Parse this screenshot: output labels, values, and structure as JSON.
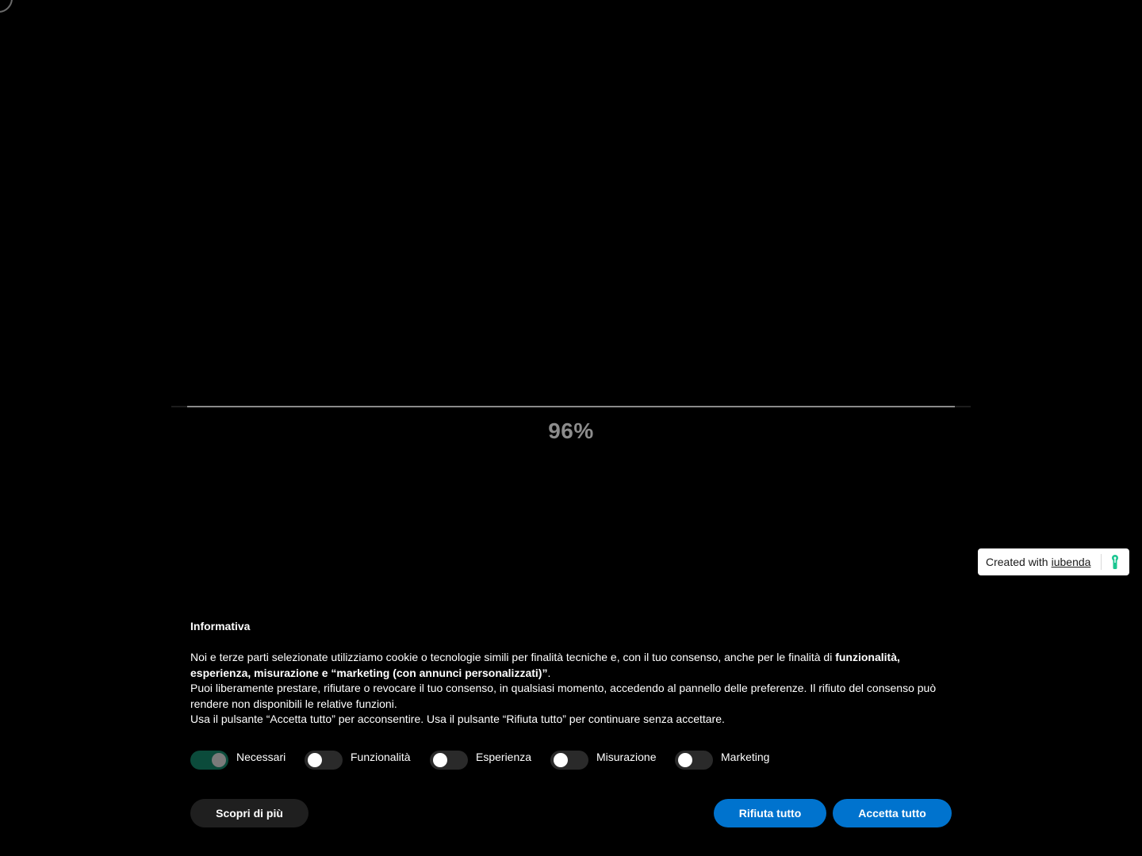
{
  "loader": {
    "percent_label": "96%",
    "progress": 0.96
  },
  "iubenda": {
    "prefix": "Created with",
    "link": "iubenda",
    "icon": "iubenda-keyhole-icon",
    "icon_color": "#1cc691"
  },
  "banner": {
    "title": "Informativa",
    "text_line1_a": "Noi e terze parti selezionate utilizziamo cookie o tecnologie simili per finalità tecniche e, con il tuo consenso, anche per le finalità di ",
    "text_line1_b": "funzionalità, esperienza, misurazione e “marketing (con annunci personalizzati)”",
    "text_line1_c": ".",
    "text_line2": "Puoi liberamente prestare, rifiutare o revocare il tuo consenso, in qualsiasi momento, accedendo al pannello delle preferenze. Il rifiuto del consenso può rendere non disponibili le relative funzioni.",
    "text_line3": "Usa il pulsante “Accetta tutto” per acconsentire. Usa il pulsante “Rifiuta tutto” per continuare senza accettare.",
    "toggles": [
      {
        "label": "Necessari",
        "on": true
      },
      {
        "label": "Funzionalità",
        "on": false
      },
      {
        "label": "Esperienza",
        "on": false
      },
      {
        "label": "Misurazione",
        "on": false
      },
      {
        "label": "Marketing",
        "on": false
      }
    ],
    "buttons": {
      "more": "Scopri di più",
      "reject": "Rifiuta tutto",
      "accept": "Accetta tutto"
    }
  },
  "colors": {
    "background": "#000000",
    "accent_blue": "#0073ce",
    "toggle_on": "#0b4b3b",
    "loader_fill": "#8a8a8a"
  }
}
